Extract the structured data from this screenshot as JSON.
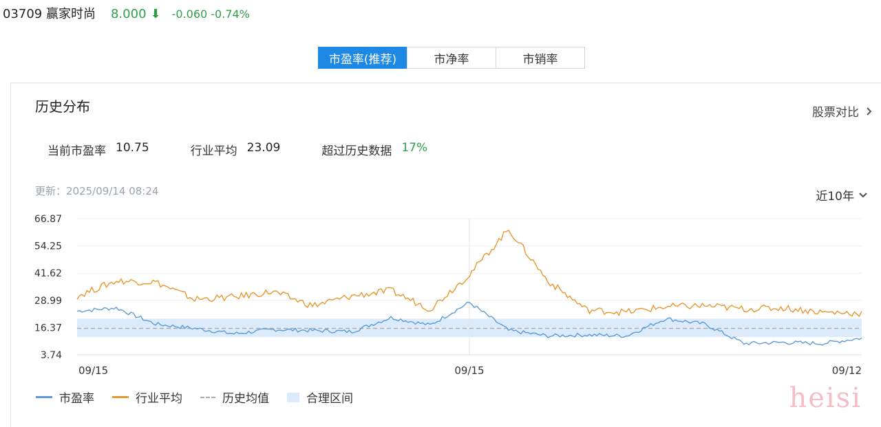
{
  "header": {
    "code_name": "03709 赢家时尚",
    "price": "8.000",
    "arrow": "⬇",
    "change": "-0.060 -0.74%"
  },
  "tabs": [
    {
      "label": "市盈率(推荐)",
      "active": true
    },
    {
      "label": "市净率",
      "active": false
    },
    {
      "label": "市销率",
      "active": false
    }
  ],
  "card": {
    "title": "历史分布",
    "compare_label": "股票对比",
    "compare_icon": "chevron-right-icon",
    "stats": [
      {
        "label": "当前市盈率",
        "value": "10.75"
      },
      {
        "label": "行业平均",
        "value": "23.09"
      },
      {
        "label": "超过历史数据",
        "value": "17%"
      }
    ],
    "updated": "更新：2025/09/14 08:24",
    "range_label": "近10年",
    "range_icon": "chevron-down-icon"
  },
  "colors": {
    "pe": "#5b9bd5",
    "industry": "#e8962e",
    "band": "#dcebfb",
    "mean": "#a4acb6",
    "accent": "#1e88e5",
    "green": "#2e9e48"
  },
  "legend": [
    {
      "label": "市盈率",
      "type": "line",
      "color": "#5b9bd5"
    },
    {
      "label": "行业平均",
      "type": "line",
      "color": "#e8962e"
    },
    {
      "label": "历史均值",
      "type": "dash"
    },
    {
      "label": "合理区间",
      "type": "box"
    }
  ],
  "chart_data": {
    "type": "line",
    "y_ticks": [
      "66.87",
      "54.25",
      "41.62",
      "28.99",
      "16.37",
      "3.74"
    ],
    "ylim": [
      3.74,
      66.87
    ],
    "x_ticks": [
      "09/15",
      "09/15",
      "09/12"
    ],
    "x_tick_positions": [
      0,
      0.5,
      1
    ],
    "x": [
      0,
      0.05,
      0.1,
      0.15,
      0.2,
      0.25,
      0.3,
      0.35,
      0.4,
      0.45,
      0.5,
      0.55,
      0.6,
      0.65,
      0.7,
      0.75,
      0.8,
      0.85,
      0.9,
      0.95,
      1
    ],
    "series": [
      {
        "name": "市盈率",
        "color": "#5b9bd5",
        "values": [
          24.0,
          25.5,
          18.0,
          16.0,
          13.5,
          15.5,
          15.0,
          14.5,
          21.0,
          17.5,
          28.0,
          15.0,
          12.5,
          13.0,
          12.5,
          20.5,
          18.0,
          9.0,
          9.5,
          9.0,
          11.5
        ]
      },
      {
        "name": "行业平均",
        "color": "#e8962e",
        "values": [
          31.0,
          38.0,
          37.5,
          29.5,
          30.5,
          33.0,
          26.5,
          31.0,
          33.5,
          25.0,
          41.0,
          62.0,
          38.0,
          24.5,
          23.5,
          26.0,
          26.5,
          25.0,
          25.5,
          23.5,
          23.0
        ]
      }
    ],
    "mean": 16.0,
    "band": [
      12.0,
      20.5
    ]
  }
}
